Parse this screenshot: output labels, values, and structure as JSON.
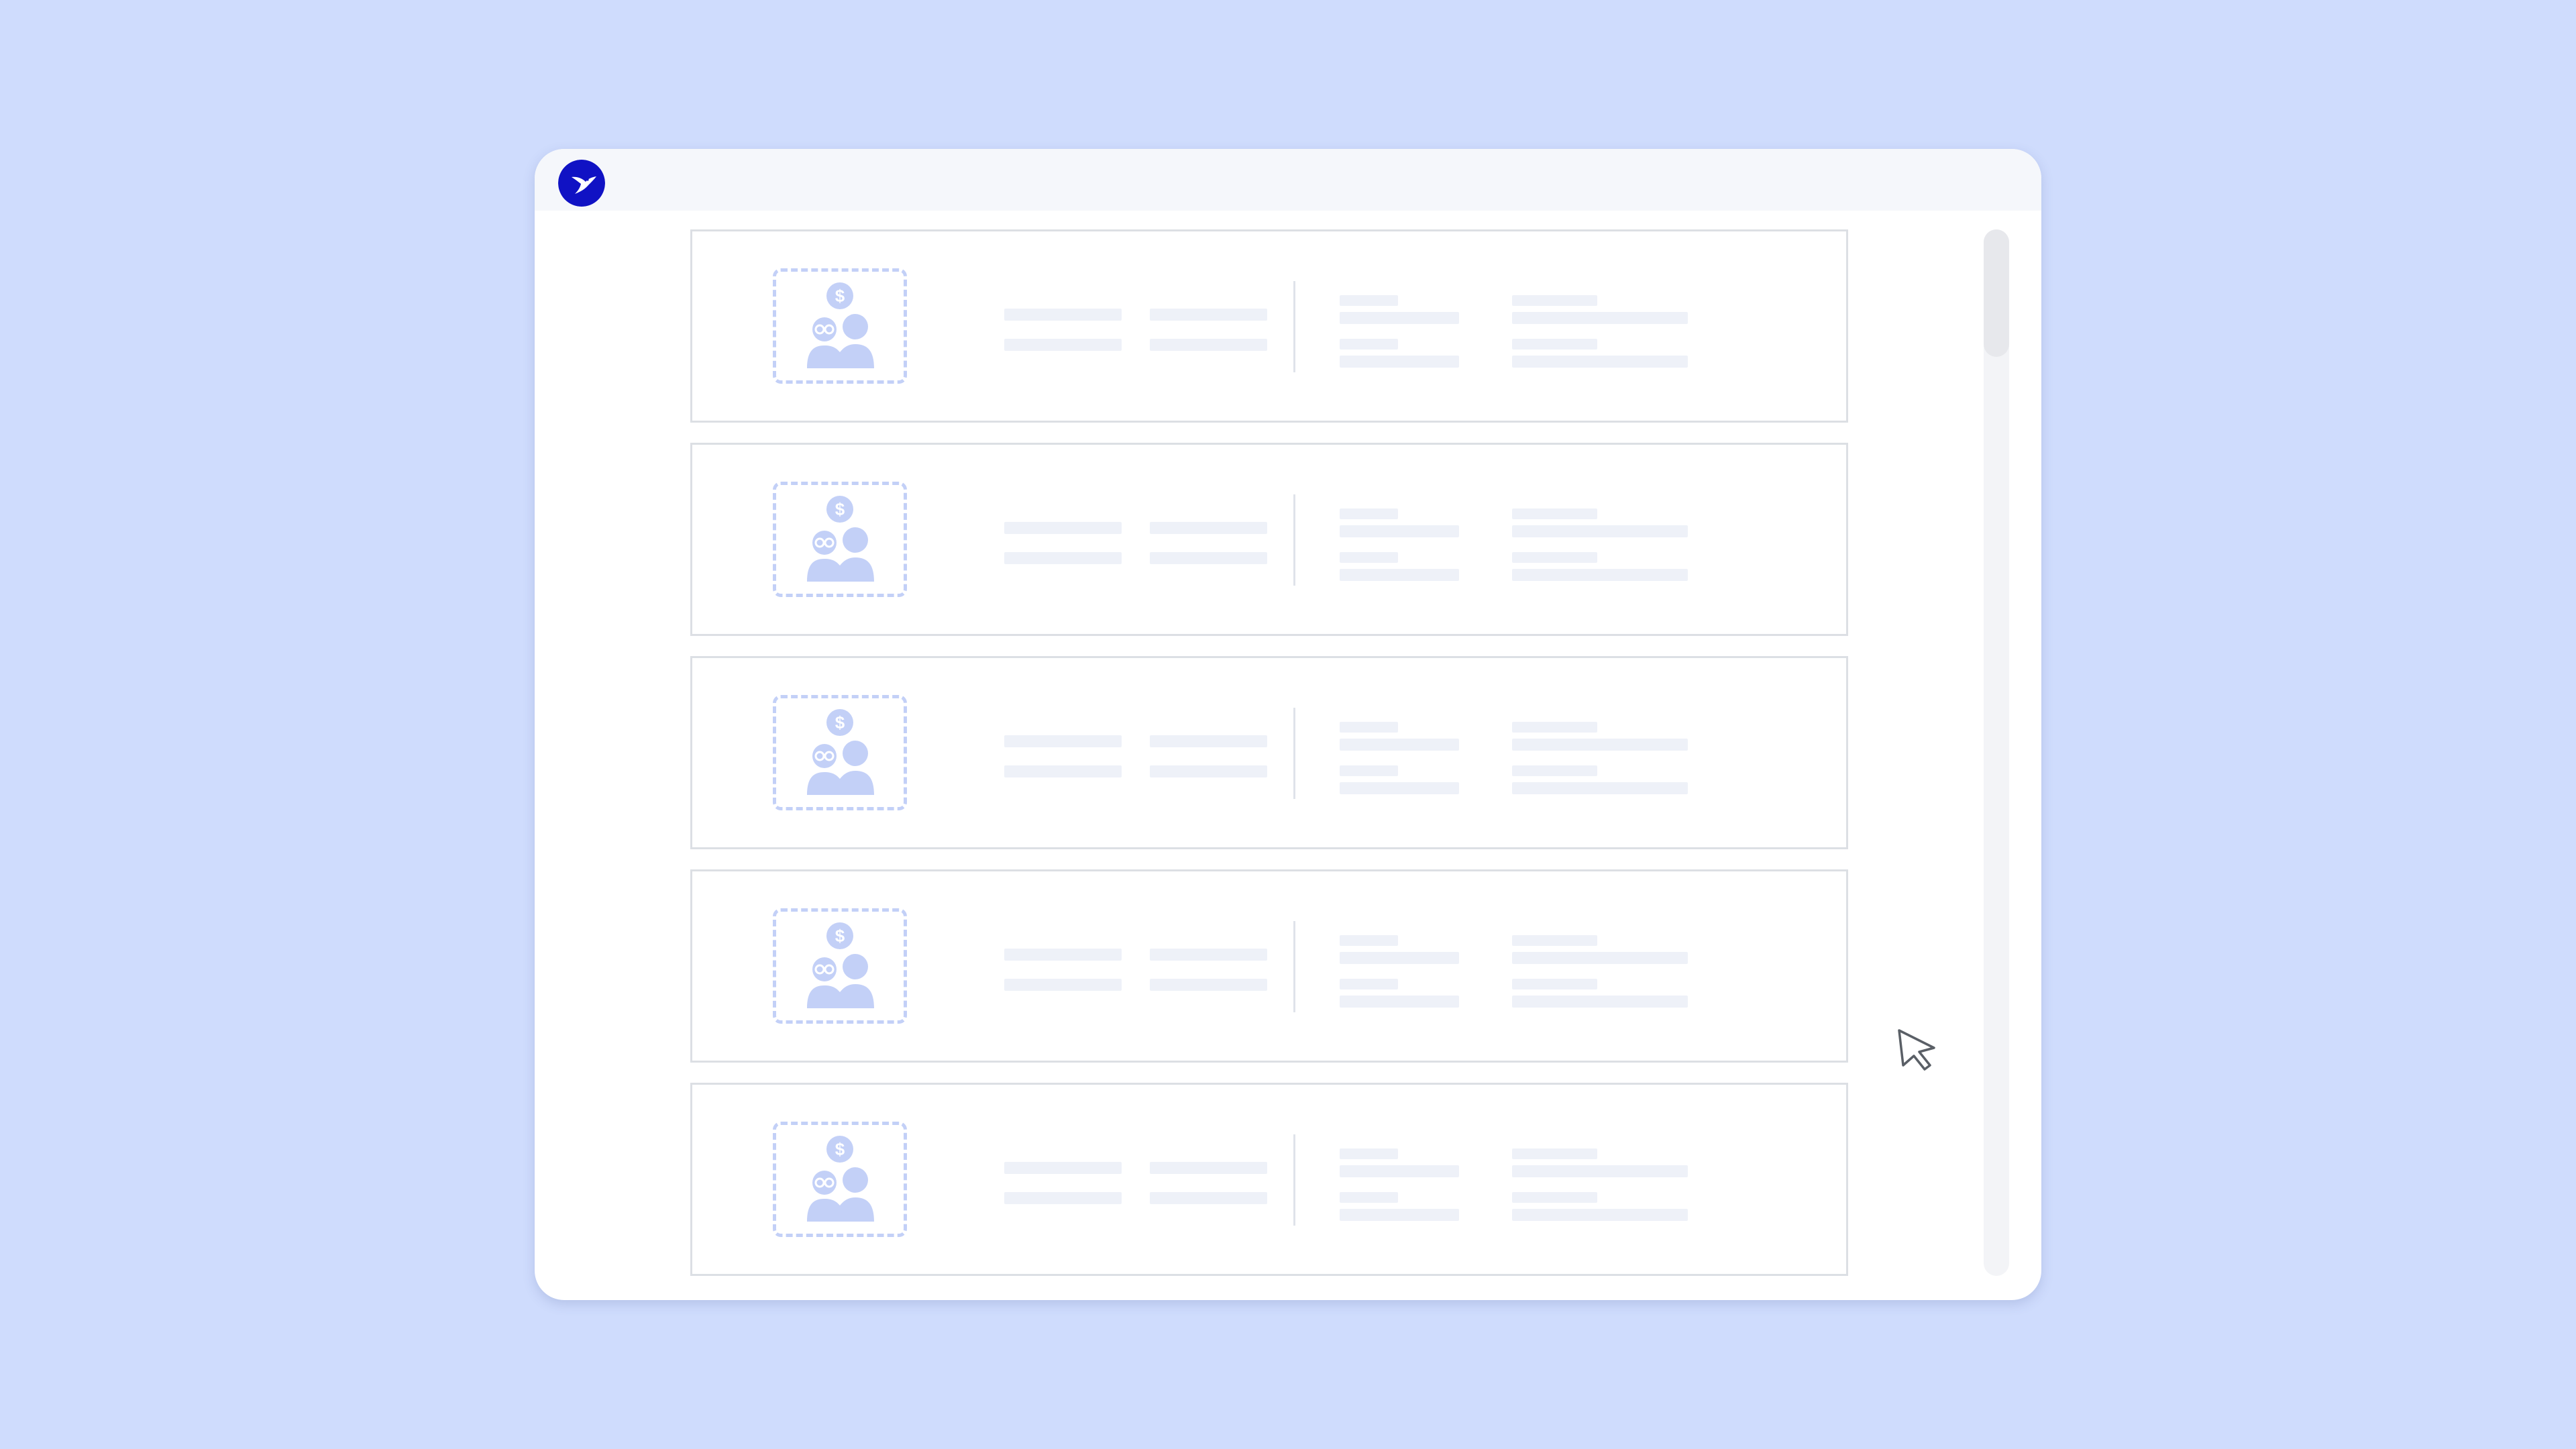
{
  "app": {
    "logo_icon": "hummingbird-logo-icon",
    "brand_color": "#1012c4"
  },
  "colors": {
    "background": "#cfdcfd",
    "window": "#ffffff",
    "titlebar": "#f5f7fb",
    "card_border": "#dcdfe4",
    "placeholder_icon": "#c3d0f7",
    "skeleton": "#eef1f8"
  },
  "list": {
    "item_icon": "user-payment-icon",
    "items": [
      {
        "state": "loading-skeleton"
      },
      {
        "state": "loading-skeleton"
      },
      {
        "state": "loading-skeleton"
      },
      {
        "state": "loading-skeleton"
      },
      {
        "state": "loading-skeleton"
      }
    ]
  },
  "cursor_icon": "mouse-pointer-icon"
}
